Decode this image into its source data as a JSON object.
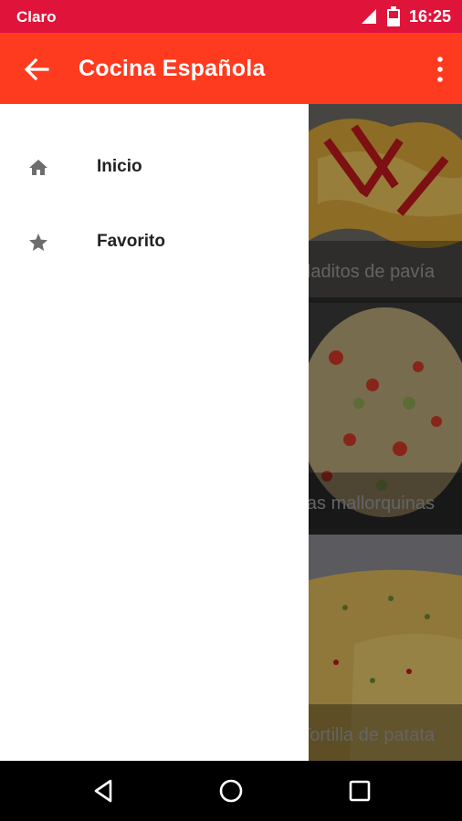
{
  "status_bar": {
    "carrier": "Claro",
    "time": "16:25"
  },
  "app_bar": {
    "title": "Cocina Española"
  },
  "drawer": {
    "items": [
      {
        "label": "Inicio",
        "icon": "home-icon"
      },
      {
        "label": "Favorito",
        "icon": "star-icon"
      }
    ]
  },
  "recipes": [
    {
      "title": "Soldaditos de pavía"
    },
    {
      "title": "Sopas mallorquinas"
    },
    {
      "title": "Tortilla de patata"
    }
  ],
  "colors": {
    "status_bar": "#e0143b",
    "app_bar": "#ff3b1f",
    "drawer": "#ffffff",
    "icon_gray": "#6d6d6d"
  }
}
